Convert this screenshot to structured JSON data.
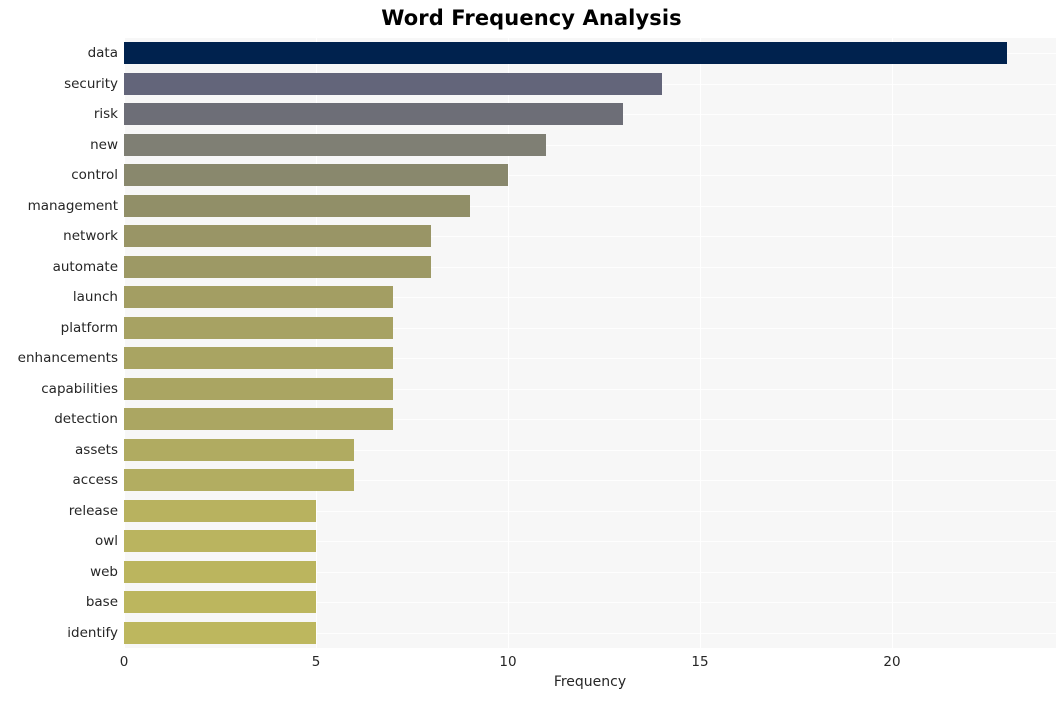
{
  "chart_data": {
    "type": "bar",
    "orientation": "horizontal",
    "title": "Word Frequency Analysis",
    "xlabel": "Frequency",
    "ylabel": "",
    "categories": [
      "data",
      "security",
      "risk",
      "new",
      "control",
      "management",
      "network",
      "automate",
      "launch",
      "platform",
      "enhancements",
      "capabilities",
      "detection",
      "assets",
      "access",
      "release",
      "owl",
      "web",
      "base",
      "identify"
    ],
    "values": [
      23,
      14,
      13,
      11,
      10,
      9,
      8,
      8,
      7,
      7,
      7,
      7,
      7,
      6,
      6,
      5,
      5,
      5,
      5,
      5
    ],
    "colors": [
      "#00224e",
      "#63657a",
      "#6d6e77",
      "#7f7f74",
      "#89886d",
      "#918f68",
      "#999566",
      "#9d9965",
      "#a39e63",
      "#a7a263",
      "#a9a462",
      "#aaa562",
      "#aba662",
      "#b0ab61",
      "#b2ad61",
      "#b8b25f",
      "#bab45f",
      "#bbb55e",
      "#bcb65e",
      "#bdb75e"
    ],
    "xlim": [
      0,
      24.27
    ],
    "ylim": [
      -0.5,
      19.5
    ],
    "xticks": [
      0,
      5,
      10,
      15,
      20
    ],
    "xtick_labels": [
      "0",
      "5",
      "10",
      "15",
      "20"
    ],
    "grid": true,
    "grid_color": "#ffffff",
    "legend": null,
    "plot_background": "#f7f7f7",
    "figure_background": "#ffffff",
    "colormap": "cividis",
    "bars": [
      {
        "label": "data",
        "value": 23,
        "color": "#00224e"
      },
      {
        "label": "security",
        "value": 14,
        "color": "#63657a"
      },
      {
        "label": "risk",
        "value": 13,
        "color": "#6d6e77"
      },
      {
        "label": "new",
        "value": 11,
        "color": "#7f7f74"
      },
      {
        "label": "control",
        "value": 10,
        "color": "#89886d"
      },
      {
        "label": "management",
        "value": 9,
        "color": "#918f68"
      },
      {
        "label": "network",
        "value": 8,
        "color": "#999566"
      },
      {
        "label": "automate",
        "value": 8,
        "color": "#9d9965"
      },
      {
        "label": "launch",
        "value": 7,
        "color": "#a39e63"
      },
      {
        "label": "platform",
        "value": 7,
        "color": "#a7a263"
      },
      {
        "label": "enhancements",
        "value": 7,
        "color": "#a9a462"
      },
      {
        "label": "capabilities",
        "value": 7,
        "color": "#aaa562"
      },
      {
        "label": "detection",
        "value": 7,
        "color": "#aba662"
      },
      {
        "label": "assets",
        "value": 6,
        "color": "#b0ab61"
      },
      {
        "label": "access",
        "value": 6,
        "color": "#b2ad61"
      },
      {
        "label": "release",
        "value": 5,
        "color": "#b8b25f"
      },
      {
        "label": "owl",
        "value": 5,
        "color": "#bab45f"
      },
      {
        "label": "web",
        "value": 5,
        "color": "#bbb55e"
      },
      {
        "label": "base",
        "value": 5,
        "color": "#bcb65e"
      },
      {
        "label": "identify",
        "value": 5,
        "color": "#bdb75e"
      }
    ]
  }
}
